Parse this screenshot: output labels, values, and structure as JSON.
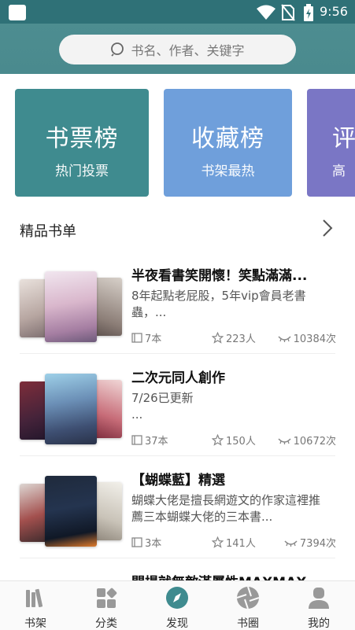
{
  "status_bar": {
    "time": "9:56"
  },
  "search": {
    "placeholder": "书名、作者、关键字"
  },
  "rank_cards": [
    {
      "title": "书票榜",
      "subtitle": "热门投票"
    },
    {
      "title": "收藏榜",
      "subtitle": "书架最热"
    },
    {
      "title": "评",
      "subtitle": "高"
    }
  ],
  "section": {
    "title": "精品书单"
  },
  "books": [
    {
      "title": "半夜看書笑開懷！笑點滿滿...",
      "desc": "8年起點老屁股，5年vip會員老書蟲，...",
      "count": "7本",
      "likes": "223人",
      "views": "10384次"
    },
    {
      "title": "二次元同人創作",
      "desc": "7/26已更新\n...",
      "count": "37本",
      "likes": "150人",
      "views": "10672次"
    },
    {
      "title": "【蝴蝶藍】精選",
      "desc": "蝴蝶大佬是擅長網遊文的作家這裡推薦三本蝴蝶大佬的三本書...",
      "count": "3本",
      "likes": "141人",
      "views": "7394次"
    },
    {
      "title": "開場就無敵滿屬性MAXMAX",
      "desc": "",
      "count": "",
      "likes": "",
      "views": ""
    }
  ],
  "nav": [
    {
      "label": "书架"
    },
    {
      "label": "分类"
    },
    {
      "label": "发现"
    },
    {
      "label": "书圈"
    },
    {
      "label": "我的"
    }
  ],
  "colors": {
    "header": "#4a8a8e",
    "active_tab": "#3f8b8f",
    "card1": "#3f8b8f",
    "card2": "#6f9fdb",
    "card3": "#7a76c5"
  }
}
